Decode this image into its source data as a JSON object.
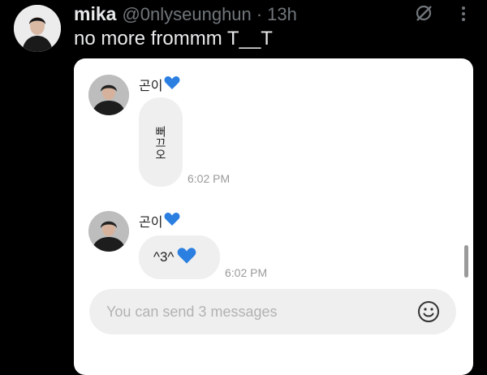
{
  "tweet": {
    "name": "mika",
    "handle": "@0nlyseunghun",
    "separator": "·",
    "time": "13h",
    "text": "no more frommm T__T"
  },
  "icons": {
    "grok": "grok-icon",
    "more": "more-icon",
    "heart": "blue-heart-icon",
    "emoji": "smiley-face-icon"
  },
  "chat": {
    "messages": [
      {
        "sender": "곤이",
        "text": "뻐끄오",
        "time": "6:02 PM"
      },
      {
        "sender": "곤이",
        "text": "^3^",
        "time": "6:02 PM"
      }
    ],
    "composer_placeholder": "You can send 3 messages"
  },
  "colors": {
    "background": "#000000",
    "name": "#e7e9ea",
    "secondary": "#71767b",
    "card": "#ffffff",
    "bubble": "#efefef",
    "heart": "#2b7fe0"
  }
}
